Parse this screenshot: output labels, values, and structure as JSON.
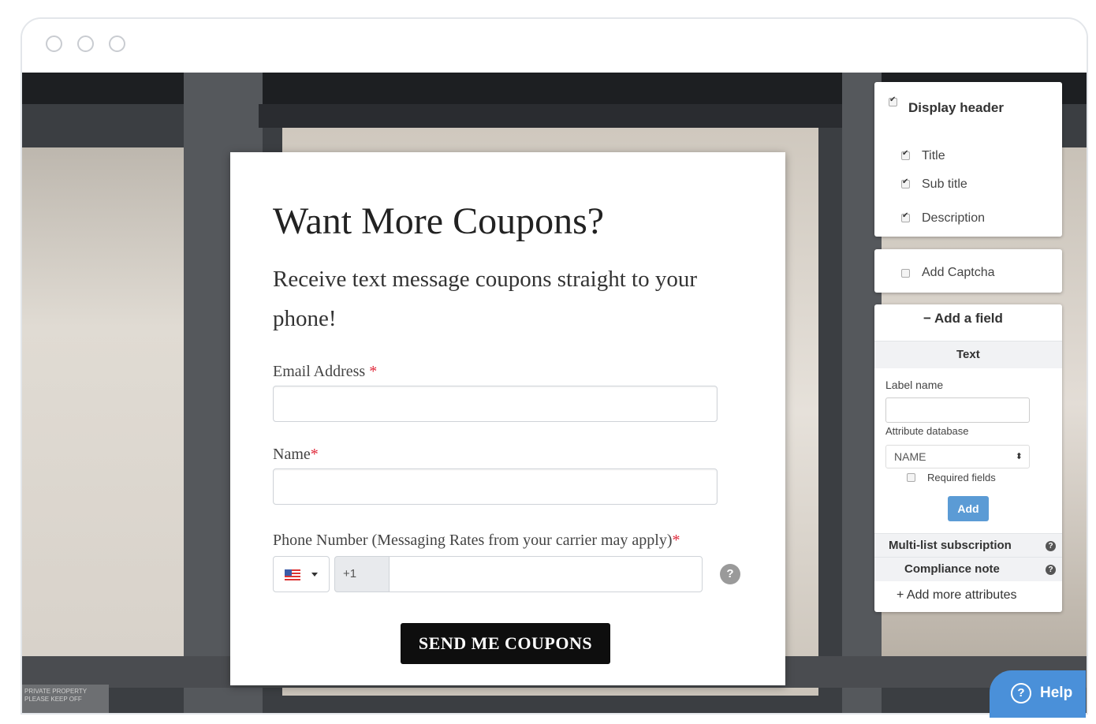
{
  "form": {
    "title": "Want More Coupons?",
    "subtitle": "Receive text message coupons straight to your phone!",
    "email_label": "Email Address",
    "name_label": "Name",
    "phone_label": "Phone Number (Messaging Rates from your carrier may apply)",
    "required_mark": "*",
    "phone_prefix": "+1",
    "help_mark": "?",
    "submit_label": "SEND ME COUPONS"
  },
  "panel": {
    "display_header": "Display header",
    "title": "Title",
    "sub_title": "Sub title",
    "description": "Description",
    "add_captcha": "Add Captcha",
    "add_field": "− Add a field",
    "text_section": "Text",
    "label_name": "Label name",
    "attribute_database": "Attribute database",
    "attribute_value": "NAME",
    "required_fields": "Required fields",
    "add_button": "Add",
    "multi_list": "Multi-list subscription",
    "compliance": "Compliance note",
    "add_more": "+ Add more attributes"
  },
  "sign": {
    "line1": "PRIVATE PROPERTY",
    "line2": "PLEASE KEEP OFF"
  },
  "help_widget": {
    "label": "Help",
    "icon": "?"
  },
  "colors": {
    "accent": "#4a90d9",
    "required": "#e0283a",
    "submit_bg": "#0e0e0e",
    "add_button": "#5b9bd5"
  }
}
